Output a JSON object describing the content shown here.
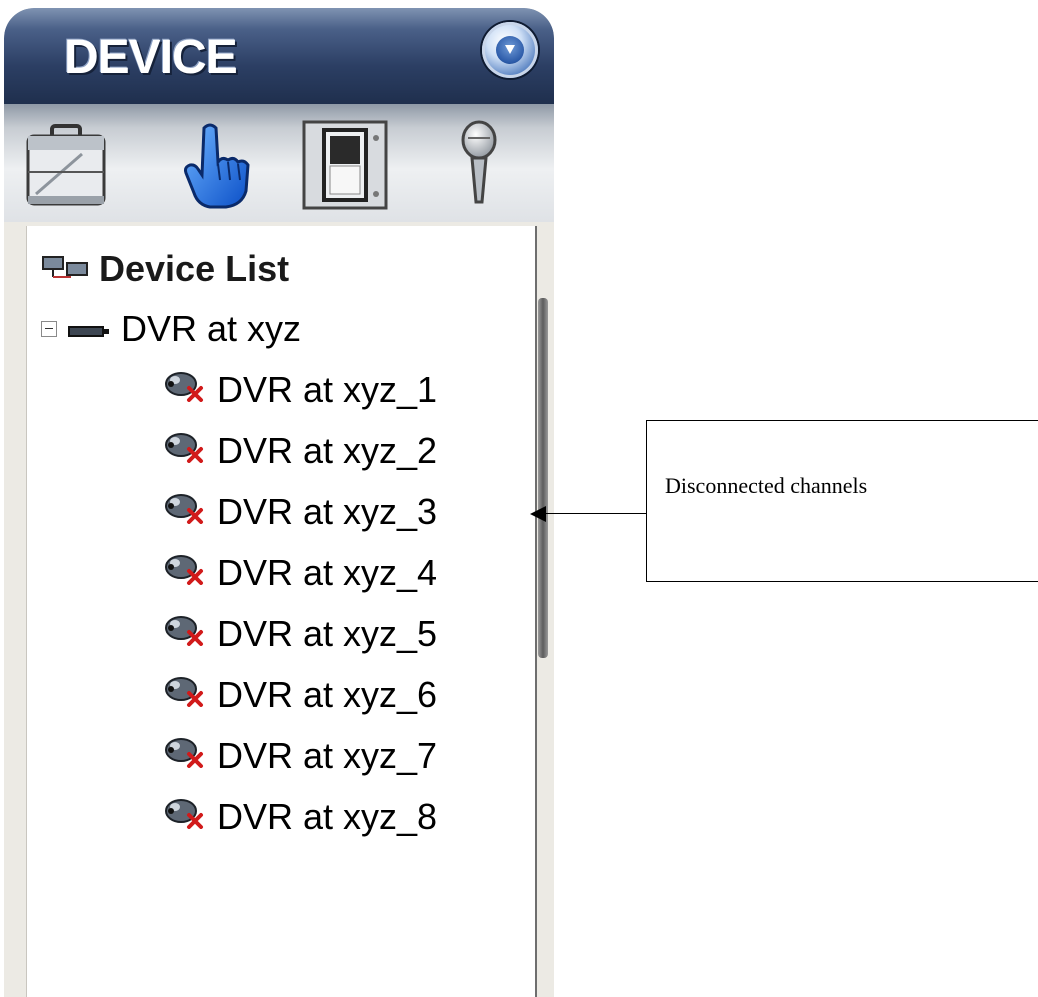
{
  "panel": {
    "title": "DEVICE",
    "toolbar": [
      {
        "name": "briefcase-icon"
      },
      {
        "name": "pointing-hand-icon"
      },
      {
        "name": "switch-icon"
      },
      {
        "name": "microphone-icon"
      }
    ]
  },
  "tree": {
    "root_label": "Device List",
    "group_label": "DVR at xyz",
    "group_expanded": true,
    "channels": [
      {
        "label": "DVR at xyz_1",
        "status": "disconnected"
      },
      {
        "label": "DVR at xyz_2",
        "status": "disconnected"
      },
      {
        "label": "DVR at xyz_3",
        "status": "disconnected"
      },
      {
        "label": "DVR at xyz_4",
        "status": "disconnected"
      },
      {
        "label": "DVR at xyz_5",
        "status": "disconnected"
      },
      {
        "label": "DVR at xyz_6",
        "status": "disconnected"
      },
      {
        "label": "DVR at xyz_7",
        "status": "disconnected"
      },
      {
        "label": "DVR at xyz_8",
        "status": "disconnected"
      }
    ]
  },
  "annotation": {
    "text": "Disconnected channels"
  },
  "colors": {
    "titlebar": "#2c3f64",
    "disconnected_mark": "#d11a1a"
  }
}
